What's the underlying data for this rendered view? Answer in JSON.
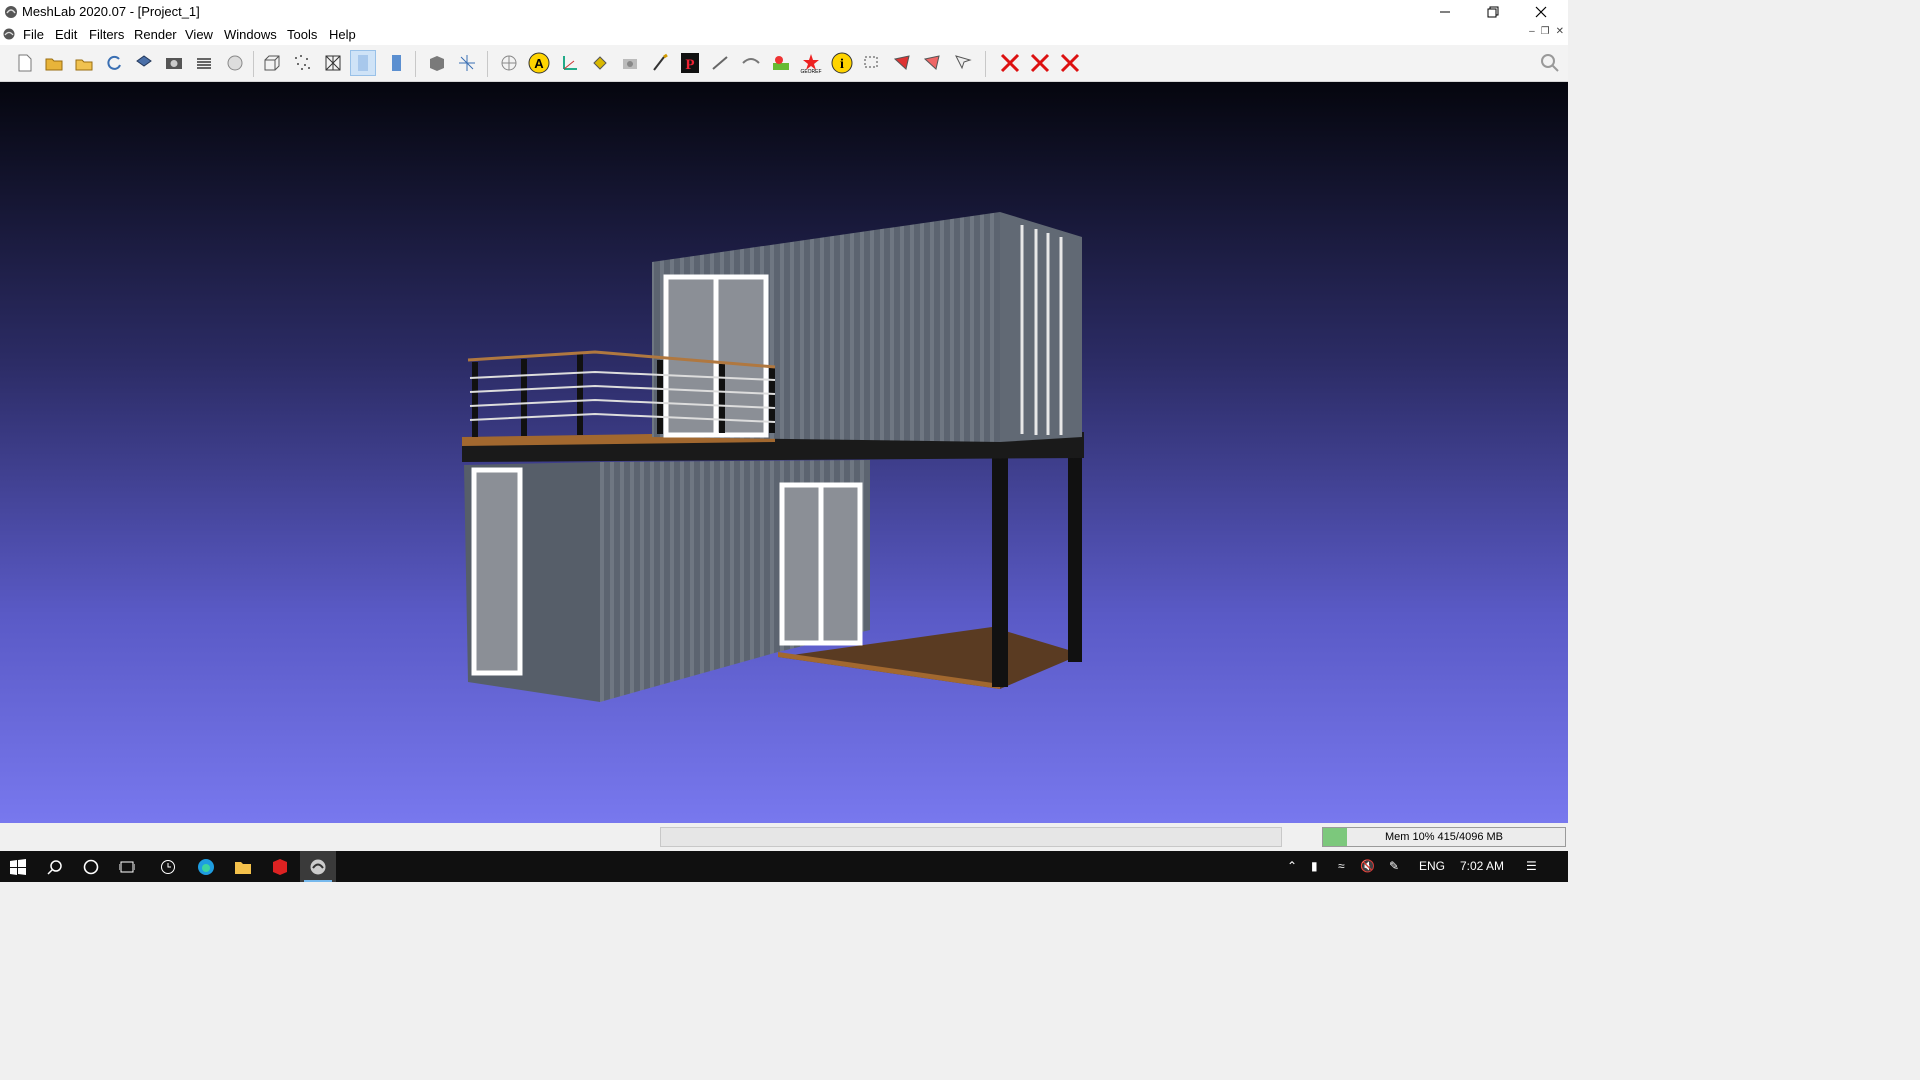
{
  "window": {
    "title": "MeshLab 2020.07 - [Project_1]"
  },
  "menu": [
    "File",
    "Edit",
    "Filters",
    "Render",
    "View",
    "Windows",
    "Tools",
    "Help"
  ],
  "status": {
    "memory_label": "Mem 10% 415/4096 MB",
    "memory_fraction": 0.1
  },
  "taskbar": {
    "language": "ENG",
    "time": "7:02 AM"
  },
  "toolbar_icons": [
    "new-project-icon",
    "open-project-icon",
    "import-mesh-icon",
    "reload-icon",
    "export-mesh-icon",
    "snapshot-icon",
    "layers-icon",
    "raster-icon",
    "bounding-box-icon",
    "points-icon",
    "wireframe-icon",
    "flat-lines-icon",
    "flat-icon",
    "ortho-icon",
    "fit-icon",
    "light-icon",
    "annotation-icon",
    "axis-icon",
    "paint-bucket-icon",
    "camera-icon",
    "brush-icon",
    "pick-points-icon",
    "measure-icon",
    "align-icon",
    "color-picker-icon",
    "georef-icon",
    "info-icon",
    "select-icon",
    "select-faces-icon",
    "select-vertices-icon",
    "delete-face-icon",
    "delete-vertex-icon",
    "delete-all-icon"
  ],
  "colors": {
    "viewport_top": "#05060e",
    "viewport_bottom": "#7878ee",
    "memory_fill": "#7cc87c"
  }
}
